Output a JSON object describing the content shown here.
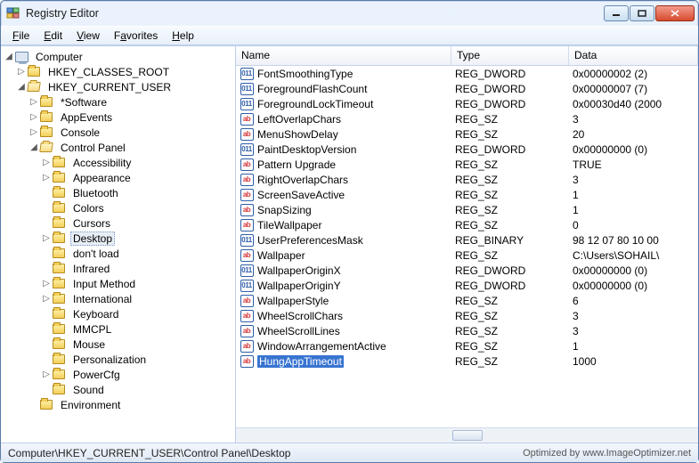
{
  "window": {
    "title": "Registry Editor"
  },
  "menu": {
    "file": "File",
    "edit": "Edit",
    "view": "View",
    "favorites": "Favorites",
    "help": "Help"
  },
  "tree": {
    "root": "Computer",
    "hkcr": "HKEY_CLASSES_ROOT",
    "hkcu": "HKEY_CURRENT_USER",
    "software": "Software",
    "appevents": "AppEvents",
    "console": "Console",
    "controlpanel": "Control Panel",
    "cp": {
      "accessibility": "Accessibility",
      "appearance": "Appearance",
      "bluetooth": "Bluetooth",
      "colors": "Colors",
      "cursors": "Cursors",
      "desktop": "Desktop",
      "dontload": "don't load",
      "infrared": "Infrared",
      "inputmethod": "Input Method",
      "international": "International",
      "keyboard": "Keyboard",
      "mmcpl": "MMCPL",
      "mouse": "Mouse",
      "personalization": "Personalization",
      "powercfg": "PowerCfg",
      "sound": "Sound"
    },
    "environment": "Environment"
  },
  "cols": {
    "name": "Name",
    "type": "Type",
    "data": "Data"
  },
  "rows": [
    {
      "icon": "dw",
      "name": "FontSmoothingType",
      "type": "REG_DWORD",
      "data": "0x00000002 (2)"
    },
    {
      "icon": "dw",
      "name": "ForegroundFlashCount",
      "type": "REG_DWORD",
      "data": "0x00000007 (7)"
    },
    {
      "icon": "dw",
      "name": "ForegroundLockTimeout",
      "type": "REG_DWORD",
      "data": "0x00030d40 (2000"
    },
    {
      "icon": "sz",
      "name": "LeftOverlapChars",
      "type": "REG_SZ",
      "data": "3"
    },
    {
      "icon": "sz",
      "name": "MenuShowDelay",
      "type": "REG_SZ",
      "data": "20"
    },
    {
      "icon": "dw",
      "name": "PaintDesktopVersion",
      "type": "REG_DWORD",
      "data": "0x00000000 (0)"
    },
    {
      "icon": "sz",
      "name": "Pattern Upgrade",
      "type": "REG_SZ",
      "data": "TRUE"
    },
    {
      "icon": "sz",
      "name": "RightOverlapChars",
      "type": "REG_SZ",
      "data": "3"
    },
    {
      "icon": "sz",
      "name": "ScreenSaveActive",
      "type": "REG_SZ",
      "data": "1"
    },
    {
      "icon": "sz",
      "name": "SnapSizing",
      "type": "REG_SZ",
      "data": "1"
    },
    {
      "icon": "sz",
      "name": "TileWallpaper",
      "type": "REG_SZ",
      "data": "0"
    },
    {
      "icon": "dw",
      "name": "UserPreferencesMask",
      "type": "REG_BINARY",
      "data": "98 12 07 80 10 00"
    },
    {
      "icon": "sz",
      "name": "Wallpaper",
      "type": "REG_SZ",
      "data": "C:\\Users\\SOHAIL\\"
    },
    {
      "icon": "dw",
      "name": "WallpaperOriginX",
      "type": "REG_DWORD",
      "data": "0x00000000 (0)"
    },
    {
      "icon": "dw",
      "name": "WallpaperOriginY",
      "type": "REG_DWORD",
      "data": "0x00000000 (0)"
    },
    {
      "icon": "sz",
      "name": "WallpaperStyle",
      "type": "REG_SZ",
      "data": "6"
    },
    {
      "icon": "sz",
      "name": "WheelScrollChars",
      "type": "REG_SZ",
      "data": "3"
    },
    {
      "icon": "sz",
      "name": "WheelScrollLines",
      "type": "REG_SZ",
      "data": "3"
    },
    {
      "icon": "sz",
      "name": "WindowArrangementActive",
      "type": "REG_SZ",
      "data": "1"
    },
    {
      "icon": "sz",
      "name": "HungAppTimeout",
      "type": "REG_SZ",
      "data": "1000",
      "selected": true
    }
  ],
  "status": {
    "path": "Computer\\HKEY_CURRENT_USER\\Control Panel\\Desktop",
    "watermark": "Optimized by www.ImageOptimizer.net"
  }
}
